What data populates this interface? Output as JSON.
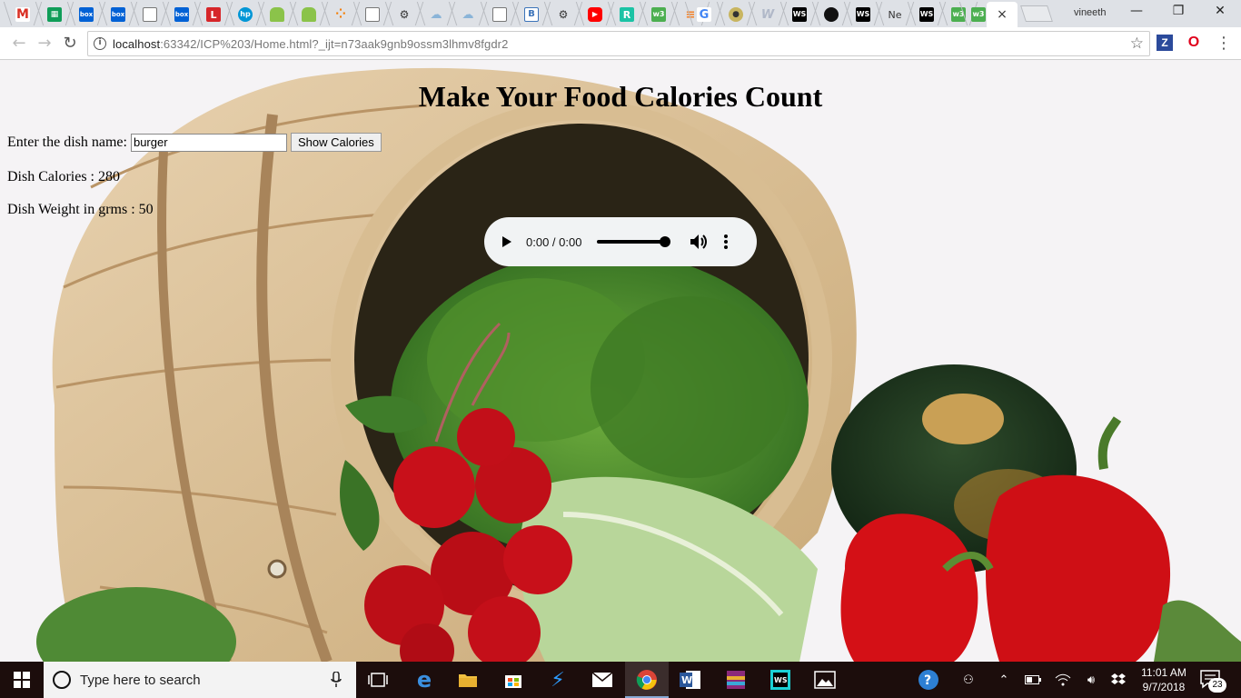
{
  "browser": {
    "url_host": "localhost",
    "url_rest": ":63342/ICP%203/Home.html?_ijt=n73aak9gnb9ossm3lhmv8fgdr2",
    "profile_name": "vineeth",
    "tab_close_glyph": "×"
  },
  "page": {
    "title": "Make Your Food Calories Count",
    "dish_label": "Enter the dish name:",
    "dish_value": "burger",
    "show_button": "Show Calories",
    "calories_text": "Dish Calories : 280",
    "weight_text": "Dish Weight in grms : 50"
  },
  "audio": {
    "time": "0:00 / 0:00",
    "volume_level": 1.0
  },
  "taskbar": {
    "search_placeholder": "Type here to search",
    "time": "11:01 AM",
    "date": "9/7/2018",
    "notification_count": "23"
  },
  "colors": {
    "tabstrip": "#dee1e6",
    "taskbar": "#1c0d0c",
    "audio_bg": "#f1f3f4"
  }
}
